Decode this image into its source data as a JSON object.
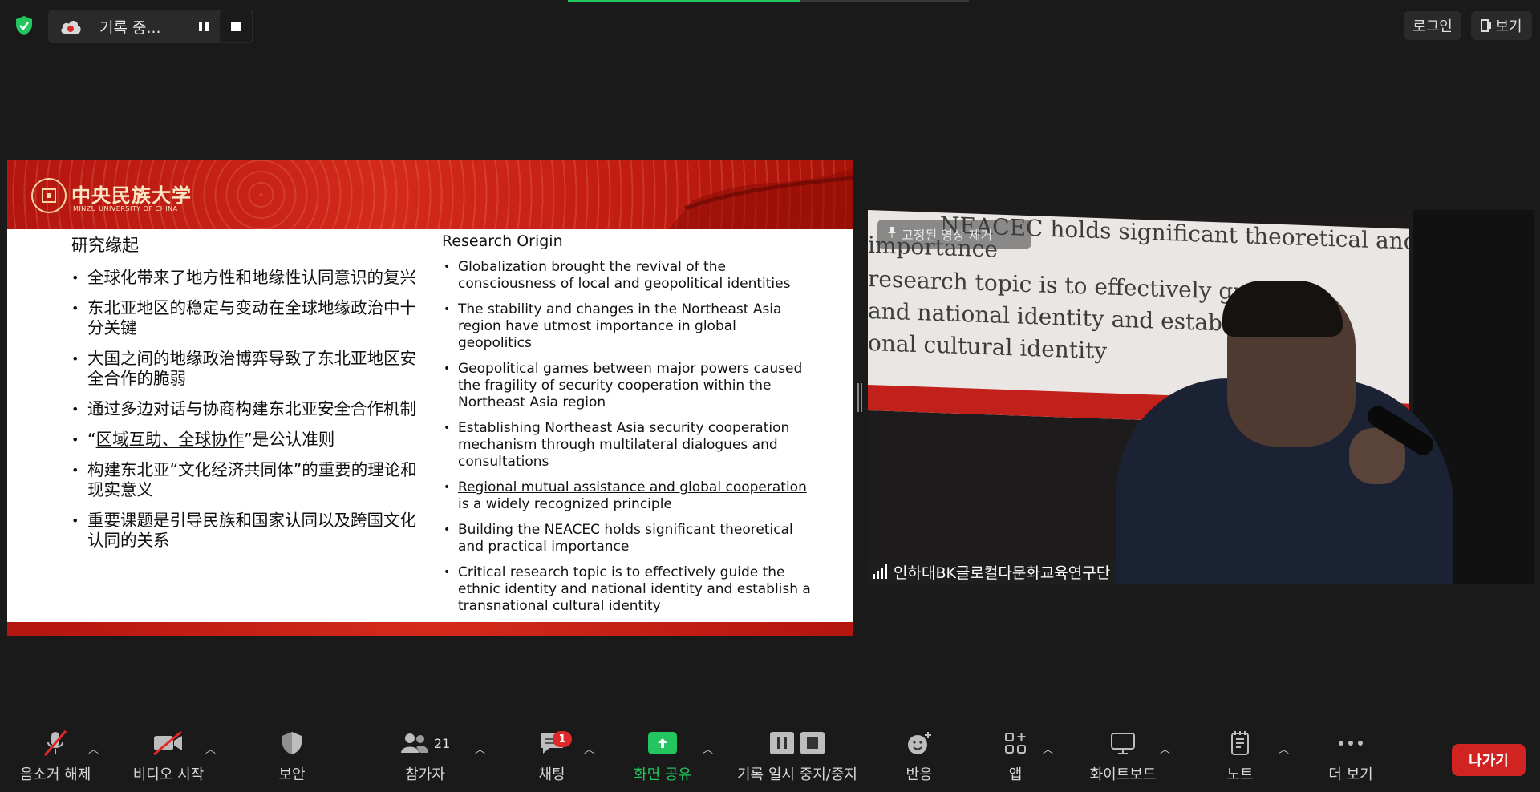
{
  "top_bar": {
    "recording_text": "기록 중...",
    "login_label": "로그인",
    "view_label": "보기",
    "share_progress": 0.58
  },
  "slide": {
    "university_cn": "中央民族大学",
    "university_en": "MINZU UNIVERSITY OF CHINA",
    "heading_cn": "研究缘起",
    "heading_en": "Research Origin",
    "bullets_cn": [
      "全球化带来了地方性和地缘性认同意识的复兴",
      "东北亚地区的稳定与变动在全球地缘政治中十分关键",
      "大国之间的地缘政治博弈导致了东北亚地区安全合作的脆弱",
      "通过多边对话与协商构建东北亚安全合作机制",
      {
        "pre": "“",
        "underlined": "区域互助、全球协作",
        "post": "”是公认准则"
      },
      "构建东北亚“文化经济共同体”的重要的理论和现实意义",
      "重要课题是引导民族和国家认同以及跨国文化认同的关系"
    ],
    "bullets_en": [
      "Globalization brought the revival of the consciousness of local and geopolitical identities",
      "The stability and changes in the Northeast Asia region have utmost importance in global geopolitics",
      "Geopolitical games between major powers caused the fragility of security cooperation within the Northeast Asia region",
      "Establishing Northeast Asia security cooperation mechanism through multilateral dialogues and consultations",
      {
        "underlined": "Regional mutual assistance and global cooperation",
        "post": " is a widely recognized principle"
      },
      "Building the NEACEC holds significant theoretical and practical importance",
      "Critical research topic is to effectively guide the ethnic identity and national identity and establish a transnational cultural identity"
    ]
  },
  "video": {
    "pin_label": "고정된 영상 제거",
    "participant_name": "인하대BK글로컬다문화교육연구단",
    "projected_text": [
      "NEACEC holds significant theoretical and",
      "importance",
      "research topic is to effectively guid",
      "and national identity and establis",
      "onal cultural identity"
    ]
  },
  "toolbar": {
    "unmute": "음소거 해제",
    "start_video": "비디오 시작",
    "security": "보안",
    "participants": "참가자",
    "participants_count": "21",
    "chat": "채팅",
    "chat_badge": "1",
    "share_screen": "화면 공유",
    "pause_stop_recording": "기록 일시 중지/중지",
    "reactions": "반응",
    "apps": "앱",
    "whiteboard": "화이트보드",
    "notes": "노트",
    "more": "더 보기",
    "leave": "나가기"
  },
  "colors": {
    "background": "#1a1a1a",
    "share_green": "#22c55e",
    "leave_red": "#d22323",
    "slide_red": "#c41e14"
  }
}
